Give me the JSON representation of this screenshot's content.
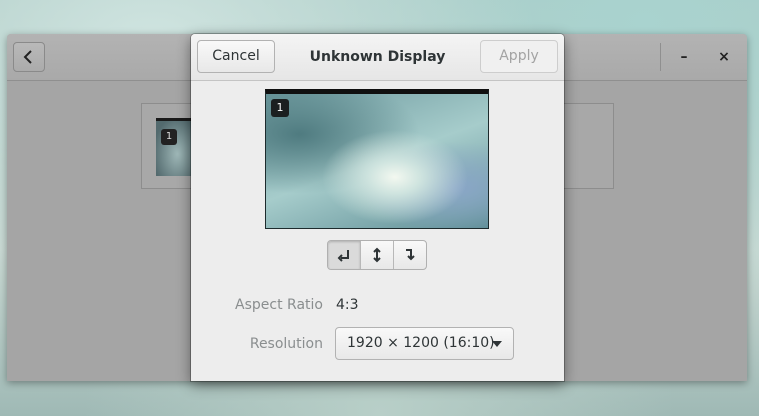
{
  "background_window": {
    "back_icon": "chevron-left-icon",
    "minimize_label": "–",
    "close_label": "×",
    "monitor_badge": "1"
  },
  "dialog": {
    "cancel_label": "Cancel",
    "title": "Unknown Display",
    "apply_label": "Apply",
    "preview_badge": "1",
    "rotation_buttons": [
      {
        "icon": "rotate-left-icon",
        "selected": true
      },
      {
        "icon": "flip-vertical-icon",
        "selected": false
      },
      {
        "icon": "rotate-right-icon",
        "selected": false
      }
    ],
    "aspect_ratio_label": "Aspect Ratio",
    "aspect_ratio_value": "4:3",
    "resolution_label": "Resolution",
    "resolution_value": "1920 × 1200 (16:10)"
  },
  "colors": {
    "dim_window": "#a5a5a5",
    "dialog_bg": "#ededed",
    "text_primary": "#2e3436",
    "text_secondary": "#8a8e8f"
  }
}
